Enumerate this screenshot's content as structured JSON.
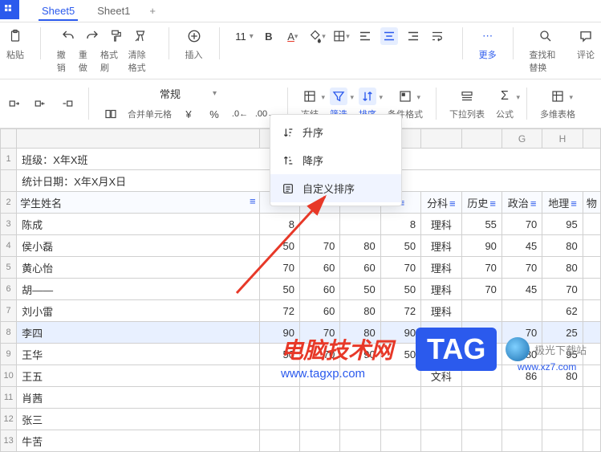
{
  "tabs": {
    "active": "Sheet5",
    "other": "Sheet1"
  },
  "toolbar": {
    "undo": "撤销",
    "redo": "重做",
    "paint": "格式刷",
    "clear": "清除格式",
    "insert": "插入",
    "fontSize": "11",
    "more": "更多",
    "find": "查找和替换",
    "comment": "评论"
  },
  "toolbar2": {
    "merge": "合并单元格",
    "freeze": "冻结",
    "filter": "筛选",
    "sort": "排序",
    "cond": "条件格式",
    "dropdown": "下拉列表",
    "formula": "公式",
    "multi": "多维表格",
    "format": "常规"
  },
  "dropdown": {
    "asc": "升序",
    "desc": "降序",
    "custom": "自定义排序"
  },
  "colhdrs": {
    "g": "G",
    "h": "H"
  },
  "info": {
    "class": "班级：X年X班",
    "date": "统计日期：X年X月X日"
  },
  "headers": {
    "name": "学生姓名",
    "track": "分科",
    "hist": "历史",
    "pol": "政治",
    "geo": "地理",
    "phy": "物"
  },
  "rows": [
    {
      "n": "3",
      "name": "陈成",
      "c1": "8",
      "track": "理科",
      "hist": "55",
      "pol": "70",
      "geo": "95"
    },
    {
      "n": "4",
      "name": "侯小磊",
      "c1": "50",
      "c2": "70",
      "c3": "80",
      "track": "理科",
      "hist": "90",
      "pol": "45",
      "geo": "80"
    },
    {
      "n": "5",
      "name": "黄心怡",
      "c1": "70",
      "c2": "60",
      "c3": "60",
      "track": "理科",
      "hist": "70",
      "pol": "70",
      "geo": "80"
    },
    {
      "n": "6",
      "name": "胡——",
      "c1": "50",
      "c2": "60",
      "c3": "50",
      "track": "理科",
      "hist": "70",
      "pol": "45",
      "geo": "70"
    },
    {
      "n": "7",
      "name": "刘小雷",
      "c1": "72",
      "c2": "60",
      "c3": "80",
      "track": "理科",
      "hist": "",
      "pol": "",
      "geo": "62"
    },
    {
      "n": "8",
      "name": "李四",
      "c1": "90",
      "c2": "70",
      "c3": "80",
      "track": "理科",
      "hist": "70",
      "pol": "70",
      "geo": "25"
    },
    {
      "n": "9",
      "name": "王华",
      "c1": "50",
      "c2": "70",
      "c3": "90",
      "track": "文科",
      "hist": "80",
      "pol": "80",
      "geo": "95"
    },
    {
      "n": "10",
      "name": "王五",
      "c1": "",
      "c2": "",
      "c3": "",
      "track": "文科",
      "hist": "",
      "pol": "86",
      "geo": "80"
    },
    {
      "n": "11",
      "name": "肖茜",
      "c1": "",
      "c2": "",
      "c3": "",
      "track": "",
      "hist": "",
      "pol": "",
      "geo": ""
    },
    {
      "n": "12",
      "name": "张三",
      "c1": "",
      "c2": "",
      "c3": "",
      "track": "",
      "hist": "",
      "pol": "",
      "geo": ""
    },
    {
      "n": "13",
      "name": "牛苦",
      "c1": "",
      "c2": "",
      "c3": "",
      "track": "",
      "hist": "",
      "pol": "",
      "geo": ""
    }
  ],
  "watermark": {
    "title": "电脑技术网",
    "url": "www.tagxp.com",
    "tag": "TAG",
    "jg": "极光下载站",
    "jgurl": "www.xz7.com"
  }
}
